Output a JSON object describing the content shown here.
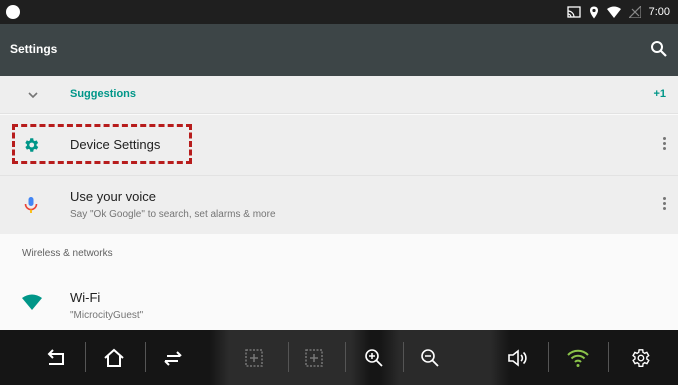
{
  "status_bar": {
    "time": "7:00"
  },
  "app_bar": {
    "title": "Settings"
  },
  "suggestions": {
    "label": "Suggestions",
    "count": "+1"
  },
  "items": [
    {
      "title": "Device Settings"
    },
    {
      "title": "Use your voice",
      "subtitle": "Say \"Ok Google\" to search, set alarms & more"
    }
  ],
  "section": {
    "label": "Wireless & networks"
  },
  "wifi": {
    "title": "Wi-Fi",
    "subtitle": "\"MicrocityGuest\""
  },
  "colors": {
    "accent": "#009688",
    "app_bar": "#3d4547",
    "highlight": "#b71c1c",
    "nav_bar": "#151515"
  }
}
